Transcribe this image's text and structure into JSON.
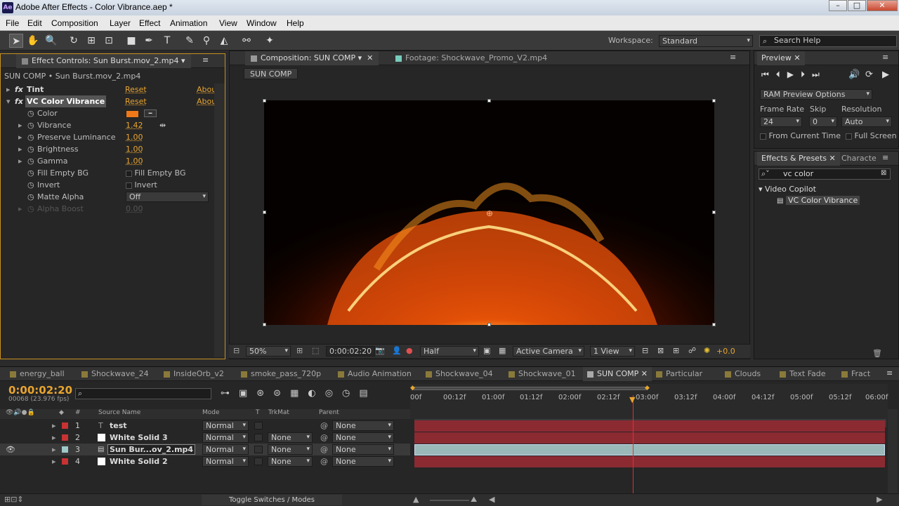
{
  "window": {
    "title": "Adobe After Effects - Color Vibrance.aep *",
    "app_icon": "Ae"
  },
  "menu": [
    "File",
    "Edit",
    "Composition",
    "Layer",
    "Effect",
    "Animation",
    "View",
    "Window",
    "Help"
  ],
  "toolbar": {
    "workspace_label": "Workspace:",
    "workspace_value": "Standard",
    "search_placeholder": "Search Help"
  },
  "effect_controls": {
    "tab": "Effect Controls: Sun Burst.mov_2.mp4",
    "breadcrumb": "SUN COMP • Sun Burst.mov_2.mp4",
    "effects": [
      {
        "name": "Tint",
        "reset": "Reset",
        "about": "Abou"
      },
      {
        "name": "VC Color Vibrance",
        "reset": "Reset",
        "about": "Abou"
      }
    ],
    "props": [
      {
        "name": "Color",
        "value": ""
      },
      {
        "name": "Vibrance",
        "value": "1.42"
      },
      {
        "name": "Preserve Luminance",
        "value": "1.00"
      },
      {
        "name": "Brightness",
        "value": "1.00"
      },
      {
        "name": "Gamma",
        "value": "1.00"
      },
      {
        "name": "Fill Empty BG",
        "value": "Fill Empty BG"
      },
      {
        "name": "Invert",
        "value": "Invert"
      },
      {
        "name": "Matte Alpha",
        "value": "Off"
      },
      {
        "name": "Alpha Boost",
        "value": "0.00"
      }
    ],
    "color_swatch": "#f07818"
  },
  "composition": {
    "tab": "Composition: SUN COMP",
    "footage_tab": "Footage: Shockwave_Promo_V2.mp4",
    "comp_button": "SUN COMP",
    "zoom": "50%",
    "timecode": "0:00:02:20",
    "resolution": "Half",
    "camera": "Active Camera",
    "views": "1 View",
    "exposure": "+0.0"
  },
  "preview": {
    "tab": "Preview",
    "ram": "RAM Preview Options",
    "frame_rate_label": "Frame Rate",
    "frame_rate": "24",
    "skip_label": "Skip",
    "skip": "0",
    "resolution_label": "Resolution",
    "resolution": "Auto",
    "from_current": "From Current Time",
    "full_screen": "Full Screen"
  },
  "effects_presets": {
    "tab": "Effects & Presets",
    "tab2": "Characte",
    "search": "vc color",
    "group": "Video Copilot",
    "item": "VC Color Vibrance"
  },
  "timeline": {
    "tabs": [
      "energy_ball",
      "Shockwave_24",
      "InsideOrb_v2",
      "smoke_pass_720p",
      "Audio Animation",
      "Shockwave_04",
      "Shockwave_01",
      "SUN COMP",
      "Particular",
      "Clouds",
      "Text Fade",
      "Fract"
    ],
    "timecode": "0:00:02:20",
    "fps": "00068 (23.976 fps)",
    "columns": {
      "num": "#",
      "source": "Source Name",
      "mode": "Mode",
      "t": "T",
      "trkmat": "TrkMat",
      "parent": "Parent"
    },
    "ruler": [
      "00f",
      "00:12f",
      "01:00f",
      "01:12f",
      "02:00f",
      "02:12f",
      "03:00f",
      "03:12f",
      "04:00f",
      "04:12f",
      "05:00f",
      "05:12f",
      "06:00f"
    ],
    "layers": [
      {
        "num": "1",
        "name": "test",
        "mode": "Normal",
        "trkmat": "",
        "parent": "None",
        "color": "#c83232"
      },
      {
        "num": "2",
        "name": "White Solid 3",
        "mode": "Normal",
        "trkmat": "None",
        "parent": "None",
        "color": "#c83232"
      },
      {
        "num": "3",
        "name": "Sun Bur...ov_2.mp4",
        "mode": "Normal",
        "trkmat": "None",
        "parent": "None",
        "color": "#9fc8c8"
      },
      {
        "num": "4",
        "name": "White Solid 2",
        "mode": "Normal",
        "trkmat": "None",
        "parent": "None",
        "color": "#c83232"
      }
    ],
    "toggle": "Toggle Switches / Modes"
  }
}
